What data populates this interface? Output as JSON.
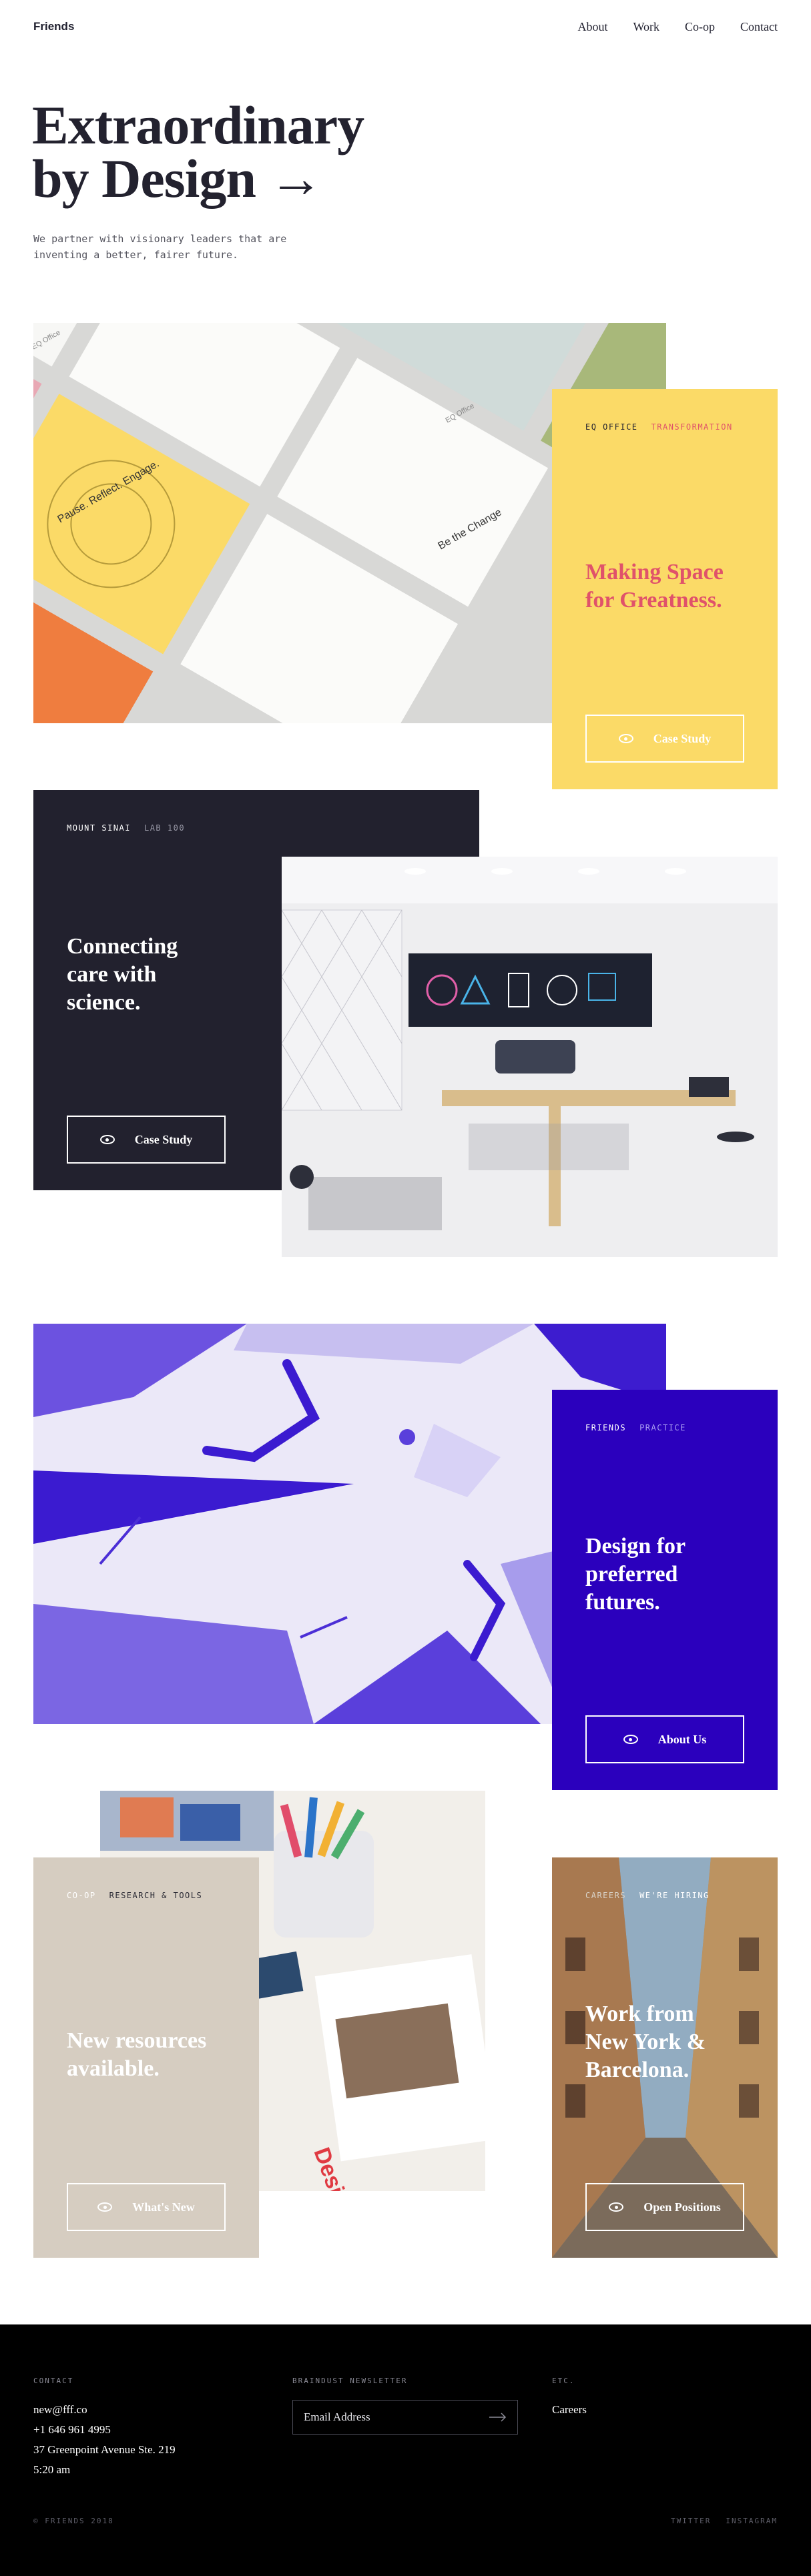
{
  "header": {
    "brand": "Friends",
    "nav": [
      "About",
      "Work",
      "Co-op",
      "Contact"
    ]
  },
  "hero": {
    "title_line1": "Extraordinary",
    "title_line2": "by Design →",
    "subtitle_line1": "We partner with visionary leaders that are",
    "subtitle_line2": "inventing a better, fairer future."
  },
  "cards": [
    {
      "client": "EQ Office",
      "tag": "Transformation",
      "title_line1": "Making Space",
      "title_line2": "for Greatness.",
      "cta": "Case Study",
      "bg": "#fbda67",
      "title_color": "#e0526a",
      "tag_color": "#e0526a"
    },
    {
      "client": "Mount Sinai",
      "tag": "Lab 100",
      "title_line1": "Connecting",
      "title_line2": "care with",
      "title_line3": "science.",
      "cta": "Case Study",
      "bg": "#22212e"
    },
    {
      "client": "Friends",
      "tag": "Practice",
      "title_line1": "Design for",
      "title_line2": "preferred",
      "title_line3": "futures.",
      "cta": "About Us",
      "bg": "#2b00bd"
    },
    {
      "client": "Co-op",
      "tag": "Research & Tools",
      "title_line1": "New resources",
      "title_line2": "available.",
      "cta": "What's New",
      "bg": "#d6cdc1"
    },
    {
      "client": "Careers",
      "tag": "We're Hiring",
      "title_line1": "Work from",
      "title_line2": "New York &",
      "title_line3": "Barcelona.",
      "cta": "Open Positions"
    }
  ],
  "illustrations": {
    "eq_card_1": "EQ Office",
    "eq_card_2": "EQ Office",
    "eq_slogan_1": "Pause. Reflect. Engage.",
    "eq_slogan_2": "Be the Change",
    "coop_poster": "Design environm back a"
  },
  "footer": {
    "contact_label": "Contact",
    "contact_email": "new@fff.co",
    "contact_phone": "+1 646 961 4995",
    "contact_address": "37 Greenpoint Avenue Ste. 219",
    "contact_time": "5:20 am",
    "newsletter_label": "Braindust Newsletter",
    "newsletter_placeholder": "Email Address",
    "etc_label": "Etc.",
    "etc_link": "Careers",
    "copyright": "© Friends 2018",
    "social": [
      "Twitter",
      "Instagram"
    ]
  },
  "colors": {
    "accent_pink": "#e0526a",
    "yellow": "#fbda67",
    "navy": "#22212e",
    "violet": "#2b00bd",
    "sand": "#d6cdc1"
  },
  "icons": [
    "eye-icon",
    "arrow-right-icon"
  ]
}
